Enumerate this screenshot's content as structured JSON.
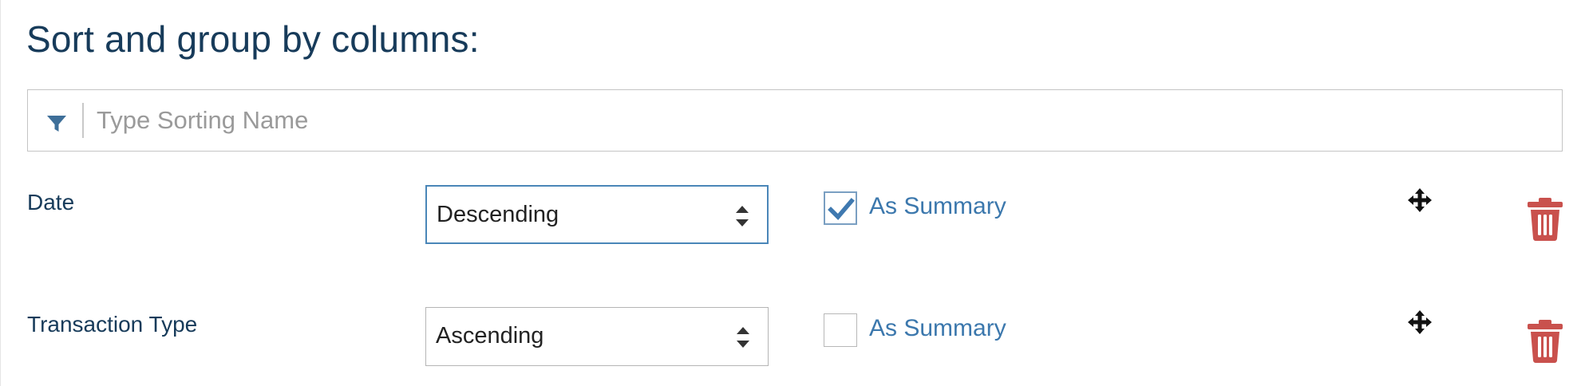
{
  "header": {
    "title": "Sort and group by columns:"
  },
  "filter": {
    "icon": "filter-icon",
    "placeholder": "Type Sorting Name",
    "value": ""
  },
  "rows": [
    {
      "label": "Date",
      "sort_order": "Descending",
      "as_summary_checked": true,
      "as_summary_label": "As Summary"
    },
    {
      "label": "Transaction Type",
      "sort_order": "Ascending",
      "as_summary_checked": false,
      "as_summary_label": "As Summary"
    }
  ],
  "colors": {
    "title": "#173b5a",
    "link": "#3c78ad",
    "delete": "#c9514d",
    "focus_border": "#4a86b8"
  },
  "icons": {
    "move": "move-icon",
    "delete": "trash-icon",
    "select_arrows": "sort-arrows-icon",
    "check": "checkmark-icon"
  }
}
